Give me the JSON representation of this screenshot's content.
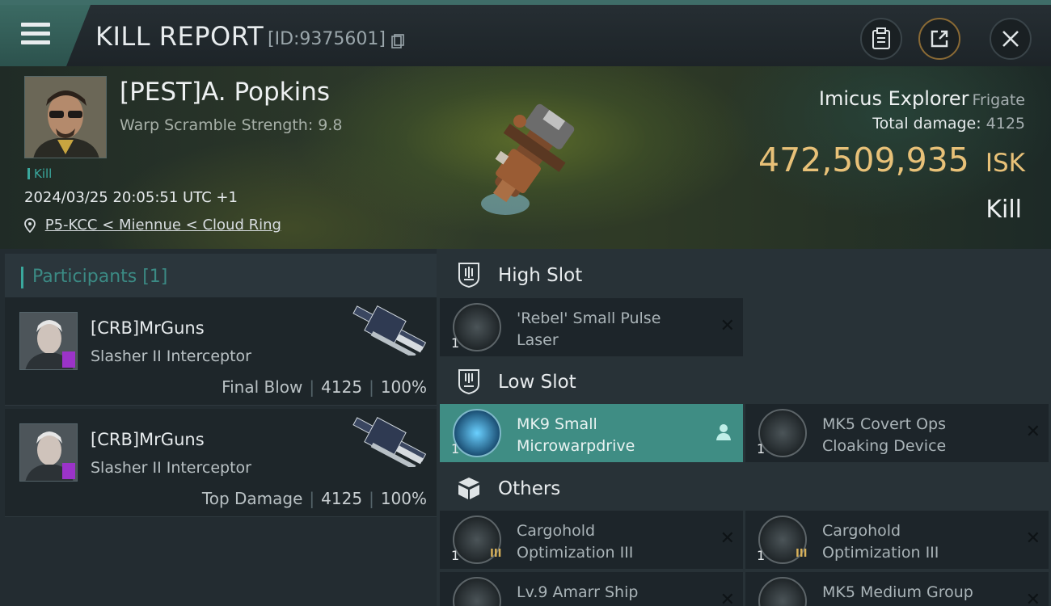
{
  "header": {
    "title": "KILL REPORT",
    "report_id": "[ID:9375601]"
  },
  "victim": {
    "name": "[PEST]A. Popkins",
    "warp_scramble": "Warp Scramble Strength: 9.8",
    "kill_tag": "Kill",
    "datetime": "2024/03/25 20:05:51 UTC +1",
    "location": "P5-KCC < Miennue < Cloud Ring"
  },
  "ship": {
    "name": "Imicus Explorer",
    "class": "Frigate",
    "total_damage_label": "Total damage:",
    "total_damage": "4125",
    "isk_value": "472,509,935",
    "isk_unit": "ISK",
    "result": "Kill"
  },
  "participants": {
    "title": "Participants [1]",
    "rows": [
      {
        "name": "[CRB]MrGuns",
        "ship": "Slasher II Interceptor",
        "role": "Final Blow",
        "damage": "4125",
        "percent": "100%"
      },
      {
        "name": "[CRB]MrGuns",
        "ship": "Slasher II Interceptor",
        "role": "Top Damage",
        "damage": "4125",
        "percent": "100%"
      }
    ]
  },
  "slots": {
    "high": {
      "label": "High Slot",
      "items": [
        {
          "line1": "'Rebel' Small Pulse",
          "line2": "Laser",
          "qty": "1"
        }
      ]
    },
    "low": {
      "label": "Low Slot",
      "items": [
        {
          "line1": "MK9 Small",
          "line2": "Microwarpdrive",
          "qty": "1"
        },
        {
          "line1": "MK5 Covert Ops",
          "line2": "Cloaking Device",
          "qty": "1"
        }
      ]
    },
    "others": {
      "label": "Others",
      "items": [
        {
          "line1": "Cargohold",
          "line2": "Optimization III",
          "qty": "1",
          "meta": "III"
        },
        {
          "line1": "Cargohold",
          "line2": "Optimization III",
          "qty": "1",
          "meta": "III"
        },
        {
          "line1": "Lv.9 Amarr Ship",
          "line2": "",
          "qty": ""
        },
        {
          "line1": "MK5 Medium Group",
          "line2": "",
          "qty": ""
        }
      ]
    }
  },
  "colors": {
    "accent": "#3aa89d",
    "isk": "#e8c178",
    "active_item": "#3f8d84"
  },
  "icons": [
    "menu-icon",
    "copy-icon",
    "clipboard-icon",
    "share-icon",
    "close-icon",
    "location-pin-icon",
    "high-slot-icon",
    "low-slot-icon",
    "others-box-icon",
    "remove-x-icon",
    "person-icon"
  ]
}
